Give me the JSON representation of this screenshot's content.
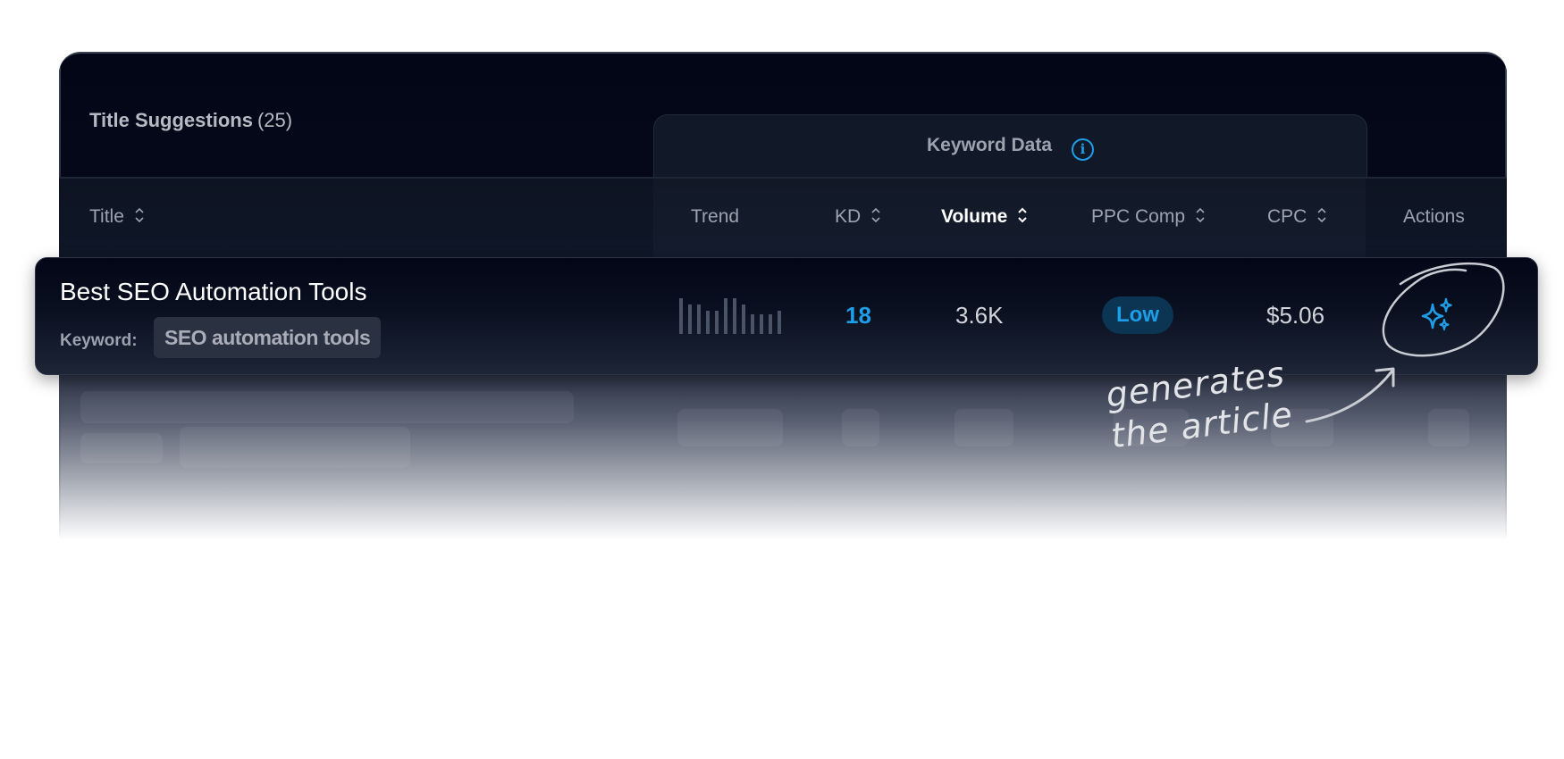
{
  "header": {
    "section_title": "Title Suggestions",
    "section_count": "(25)",
    "keyword_panel_label": "Keyword Data",
    "info_icon": "i"
  },
  "columns": [
    {
      "key": "title",
      "label": "Title",
      "sortable": true,
      "active": false
    },
    {
      "key": "trend",
      "label": "Trend",
      "sortable": false,
      "active": false
    },
    {
      "key": "kd",
      "label": "KD",
      "sortable": true,
      "active": false
    },
    {
      "key": "volume",
      "label": "Volume",
      "sortable": true,
      "active": true
    },
    {
      "key": "ppc_comp",
      "label": "PPC Comp",
      "sortable": true,
      "active": false
    },
    {
      "key": "cpc",
      "label": "CPC",
      "sortable": true,
      "active": false
    },
    {
      "key": "actions",
      "label": "Actions",
      "sortable": false,
      "active": false
    }
  ],
  "rows": [
    {
      "title": "Best SEO Automation Tools",
      "keyword_label": "Keyword:",
      "keyword": "SEO automation tools",
      "trend": [
        1.0,
        0.82,
        0.82,
        0.65,
        0.65,
        1.0,
        1.0,
        0.82,
        0.55,
        0.55,
        0.55,
        0.65
      ],
      "kd": "18",
      "volume": "3.6K",
      "ppc_comp": "Low",
      "cpc": "$5.06",
      "action_icon": "sparkles-icon"
    }
  ],
  "annotation": {
    "line1": "generates",
    "line2": "the article"
  },
  "colors": {
    "accent": "#1e9ee8",
    "badge_bg": "#0b3553",
    "card_bg": "#030616"
  }
}
